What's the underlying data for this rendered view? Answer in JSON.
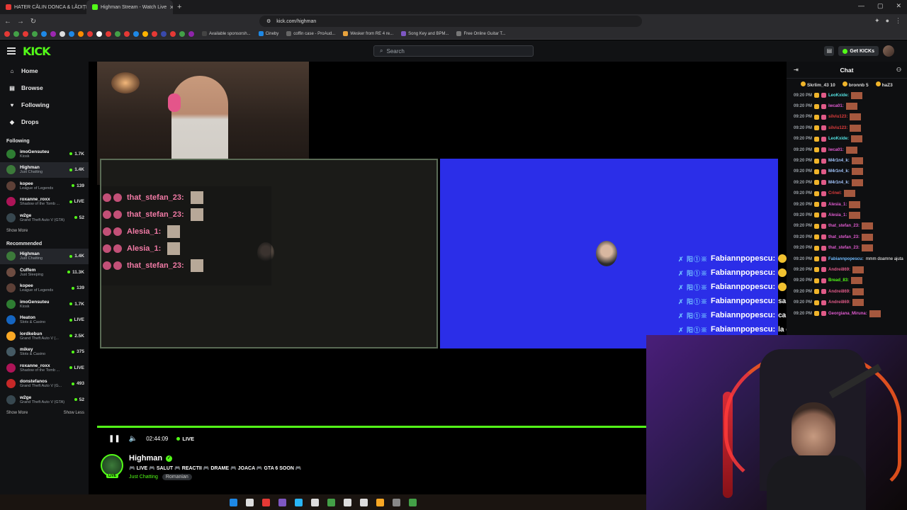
{
  "browser": {
    "tabs": [
      {
        "title": "HATER CĂLIN DONCA & LĂDIȚEII",
        "active": false,
        "favicon_color": "#e53935"
      },
      {
        "title": "Highman Stream - Watch Live",
        "active": true,
        "favicon_color": "#53fc18"
      }
    ],
    "new_tab": "+",
    "url": "kick.com/highman",
    "bookmarks": [
      {
        "label": "Available sponsorsh...",
        "color": "#444"
      },
      {
        "label": "Cineby",
        "color": "#1e88e5"
      },
      {
        "label": "coffin case - ProAud...",
        "color": "#666"
      },
      {
        "label": "Wesker from RE 4 re...",
        "color": "#e8a33d"
      },
      {
        "label": "Song Key and BPM...",
        "color": "#7e57c2"
      },
      {
        "label": "Free Online Guitar T...",
        "color": "#777"
      }
    ],
    "bookmark_icon_colors": [
      "#e53935",
      "#43a047",
      "#e53935",
      "#43a047",
      "#1e88e5",
      "#9c27b0",
      "#ddd",
      "#1e88e5",
      "#fb8c00",
      "#e53935",
      "#fff",
      "#e53935",
      "#43a047",
      "#e53935",
      "#1e88e5",
      "#ffb300",
      "#e53935",
      "#3949ab",
      "#e53935",
      "#43a047",
      "#8e24aa"
    ]
  },
  "topbar": {
    "logo": "KICK",
    "search_placeholder": "Search",
    "get_kicks": "Get KICKs"
  },
  "sidebar": {
    "nav": [
      {
        "icon": "⌂",
        "label": "Home",
        "name": "home"
      },
      {
        "icon": "▤",
        "label": "Browse",
        "name": "browse"
      },
      {
        "icon": "♥",
        "label": "Following",
        "name": "following"
      },
      {
        "icon": "◆",
        "label": "Drops",
        "name": "drops"
      }
    ],
    "following_title": "Following",
    "following": [
      {
        "name": "imoGensuteu",
        "game": "Kiosk",
        "viewers": "1.7K",
        "color": "#2e7d32",
        "selected": false
      },
      {
        "name": "Highman",
        "game": "Just Chatting",
        "viewers": "1.4K",
        "color": "#3c7a3a",
        "selected": true
      },
      {
        "name": "kopee",
        "game": "League of Legends",
        "viewers": "139",
        "color": "#5d4037",
        "selected": false
      },
      {
        "name": "roxanne_roxx",
        "game": "Shadow of the Tomb ...",
        "viewers": "LIVE",
        "color": "#ad1457",
        "selected": false
      },
      {
        "name": "w2ge",
        "game": "Grand Theft Auto V (GTA)",
        "viewers": "52",
        "color": "#37474f",
        "selected": false
      }
    ],
    "show_more": "Show More",
    "recommended_title": "Recommended",
    "recommended": [
      {
        "name": "Highman",
        "game": "Just Chatting",
        "viewers": "1.4K",
        "color": "#3c7a3a",
        "selected": true
      },
      {
        "name": "Cuffem",
        "game": "Just Sleeping",
        "viewers": "11.3K",
        "color": "#6d4c41",
        "selected": false
      },
      {
        "name": "kopee",
        "game": "League of Legends",
        "viewers": "139",
        "color": "#5d4037",
        "selected": false
      },
      {
        "name": "imoGensuteu",
        "game": "Kiosk",
        "viewers": "1.7K",
        "color": "#2e7d32",
        "selected": false
      },
      {
        "name": "Heaton",
        "game": "Slots & Casino",
        "viewers": "LIVE",
        "color": "#1565c0",
        "selected": false
      },
      {
        "name": "lordkebun",
        "game": "Grand Theft Auto V (...",
        "viewers": "2.5K",
        "color": "#f9a825",
        "selected": false
      },
      {
        "name": "mikey",
        "game": "Slots & Casino",
        "viewers": "375",
        "color": "#455a64",
        "selected": false
      },
      {
        "name": "roxanne_roxx",
        "game": "Shadow of the Tomb ...",
        "viewers": "LIVE",
        "color": "#ad1457",
        "selected": false
      },
      {
        "name": "donstefanos",
        "game": "Grand Theft Auto V (G...",
        "viewers": "493",
        "color": "#c62828",
        "selected": false
      },
      {
        "name": "w2ge",
        "game": "Grand Theft Auto V (GTA)",
        "viewers": "52",
        "color": "#37474f",
        "selected": false
      }
    ],
    "show_more_2": "Show More",
    "show_less": "Show Less"
  },
  "player": {
    "overlay_chat": [
      "that_stefan_23:",
      "that_stefan_23:",
      "Alesia_1:",
      "Alesia_1:",
      "that_stefan_23:"
    ],
    "tts_chat": [
      {
        "badges": "✗ 阳①※",
        "name": "Fabiannpopescu:",
        "msg": ""
      },
      {
        "badges": "✗ 阳①※",
        "name": "Fabiannpopescu:",
        "msg": ""
      },
      {
        "badges": "✗ 阳①※",
        "name": "Fabiannpopescu:",
        "msg": ""
      },
      {
        "badges": "✗ 阳①※",
        "name": "Fabiannpopescu:",
        "msg": "sa nu spui"
      },
      {
        "badges": "✗ 阳①※",
        "name": "Fabiannpopescu:",
        "msg": "ca a intrat"
      },
      {
        "badges": "✗ 阳①※",
        "name": "Fabiannpopescu:",
        "msg": "la debate"
      }
    ],
    "time": "02:44:09",
    "live_label": "LIVE",
    "progress": 1.0
  },
  "stream": {
    "streamer": "Highman",
    "live_badge": "LIVE",
    "title": "🎮 LIVE 🎮 SALUT 🎮 REACTII 🎮 DRAME 🎮 JOACA 🎮 GTA 6 SOON 🎮",
    "category": "Just Chatting",
    "tag": "Romanian"
  },
  "chat": {
    "title": "Chat",
    "pinned": [
      {
        "name": "Skrlim_43",
        "count": "10"
      },
      {
        "name": "bronnb",
        "count": "5"
      },
      {
        "name": "haZ3",
        "count": ""
      }
    ],
    "messages": [
      {
        "time": "09:20 PM",
        "user": "LeoKxide:",
        "color": "#53e0e0",
        "text": ""
      },
      {
        "time": "09:20 PM",
        "user": "iwca01:",
        "color": "#e05bd0",
        "text": ""
      },
      {
        "time": "09:20 PM",
        "user": "silviu123:",
        "color": "#e03c3c",
        "text": ""
      },
      {
        "time": "09:20 PM",
        "user": "silviu123:",
        "color": "#e03c3c",
        "text": ""
      },
      {
        "time": "09:20 PM",
        "user": "LeoKxide:",
        "color": "#53e0e0",
        "text": ""
      },
      {
        "time": "09:20 PM",
        "user": "iwca01:",
        "color": "#e05bd0",
        "text": ""
      },
      {
        "time": "09:20 PM",
        "user": "M4r1n4_k:",
        "color": "#a5c8ff",
        "text": ""
      },
      {
        "time": "09:20 PM",
        "user": "M4r1n4_k:",
        "color": "#a5c8ff",
        "text": ""
      },
      {
        "time": "09:20 PM",
        "user": "M4r1n4_k:",
        "color": "#a5c8ff",
        "text": ""
      },
      {
        "time": "09:20 PM",
        "user": "Crinel:",
        "color": "#e03c3c",
        "text": ""
      },
      {
        "time": "09:20 PM",
        "user": "Alesia_1:",
        "color": "#e05bd0",
        "text": ""
      },
      {
        "time": "09:20 PM",
        "user": "Alesia_1:",
        "color": "#e05bd0",
        "text": ""
      },
      {
        "time": "09:20 PM",
        "user": "that_stefan_23:",
        "color": "#e05bd0",
        "text": ""
      },
      {
        "time": "09:20 PM",
        "user": "that_stefan_23:",
        "color": "#e05bd0",
        "text": ""
      },
      {
        "time": "09:20 PM",
        "user": "that_stefan_23:",
        "color": "#e05bd0",
        "text": ""
      },
      {
        "time": "09:20 PM",
        "user": "Fabiannpopescu:",
        "color": "#6fbbff",
        "text": "mmm doamne ajuta"
      },
      {
        "time": "09:20 PM",
        "user": "Andrei869:",
        "color": "#e05b88",
        "text": ""
      },
      {
        "time": "09:20 PM",
        "user": "Bread_83:",
        "color": "#53fc18",
        "text": ""
      },
      {
        "time": "09:20 PM",
        "user": "Andrei869:",
        "color": "#e05b88",
        "text": ""
      },
      {
        "time": "09:20 PM",
        "user": "Andrei869:",
        "color": "#e05b88",
        "text": ""
      },
      {
        "time": "09:20 PM",
        "user": "Georgiana_Miruna:",
        "color": "#e05bd0",
        "text": ""
      }
    ]
  }
}
